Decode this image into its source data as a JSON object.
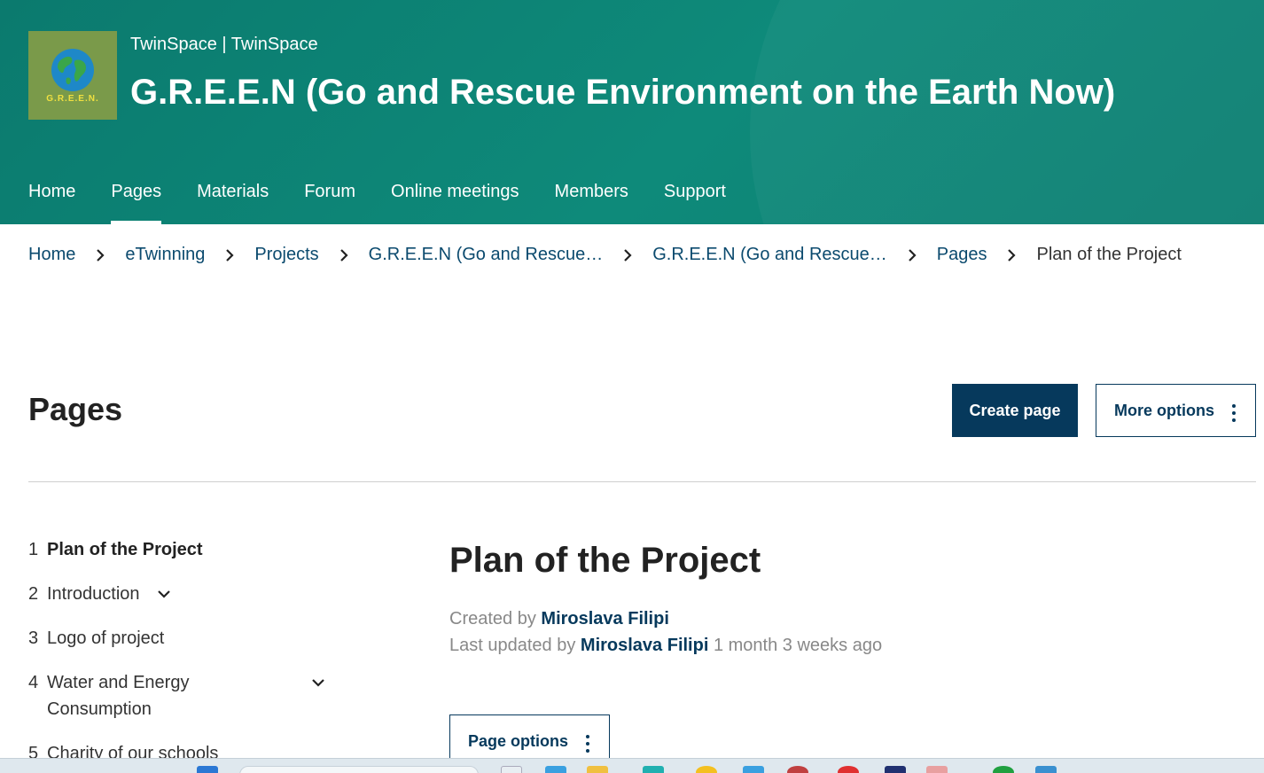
{
  "header": {
    "site_label": "TwinSpace | TwinSpace",
    "title": "G.R.E.E.N (Go and Rescue Environment on the Earth Now)",
    "logo_text": "G.R.E.E.N.",
    "bg_color": "#0e8a7a"
  },
  "nav": {
    "items": [
      {
        "label": "Home",
        "active": false
      },
      {
        "label": "Pages",
        "active": true
      },
      {
        "label": "Materials",
        "active": false
      },
      {
        "label": "Forum",
        "active": false
      },
      {
        "label": "Online meetings",
        "active": false
      },
      {
        "label": "Members",
        "active": false
      },
      {
        "label": "Support",
        "active": false
      }
    ]
  },
  "breadcrumb": {
    "items": [
      "Home",
      "eTwinning",
      "Projects",
      "G.R.E.E.N (Go and Rescue…",
      "G.R.E.E.N (Go and Rescue…",
      "Pages"
    ],
    "current": "Plan of the Project"
  },
  "pages_section": {
    "title": "Pages",
    "create_button": "Create page",
    "more_button": "More options",
    "primary_color": "#06395c"
  },
  "toc": {
    "items": [
      {
        "num": "1",
        "label": "Plan of the Project",
        "active": true,
        "expandable": false
      },
      {
        "num": "2",
        "label": "Introduction",
        "active": false,
        "expandable": true
      },
      {
        "num": "3",
        "label": "Logo of project",
        "active": false,
        "expandable": false
      },
      {
        "num": "4",
        "label": "Water and Energy Consumption",
        "active": false,
        "expandable": true
      },
      {
        "num": "5",
        "label": "Charity of our schools",
        "active": false,
        "expandable": false
      }
    ]
  },
  "page": {
    "title": "Plan of the Project",
    "created_prefix": "Created by",
    "created_author": "Miroslava Filipi",
    "updated_prefix": "Last updated by",
    "updated_author": "Miroslava Filipi",
    "updated_time": "1 month 3 weeks ago",
    "options_button": "Page options"
  }
}
